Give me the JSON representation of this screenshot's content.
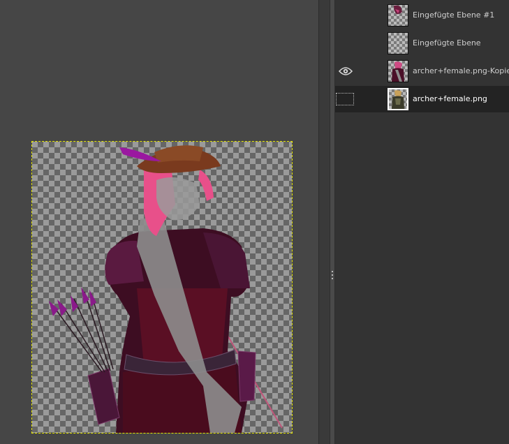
{
  "canvas": {
    "image": "archer-female-artwork"
  },
  "layers_panel": {
    "layers": [
      {
        "name": "Eingefügte Ebene #1",
        "visible": false,
        "chained": false,
        "selected": false,
        "thumb": "small-figure"
      },
      {
        "name": "Eingefügte Ebene",
        "visible": false,
        "chained": false,
        "selected": false,
        "thumb": "empty"
      },
      {
        "name": "archer+female.png-Kopie",
        "visible": true,
        "chained": false,
        "selected": false,
        "thumb": "pink-archer"
      },
      {
        "name": "archer+female.png",
        "visible": false,
        "chained": true,
        "selected": true,
        "thumb": "original-archer"
      }
    ]
  },
  "colors": {
    "selection_border": "#e6e600",
    "panel_bg": "#333333",
    "selected_row_bg": "#232323"
  }
}
